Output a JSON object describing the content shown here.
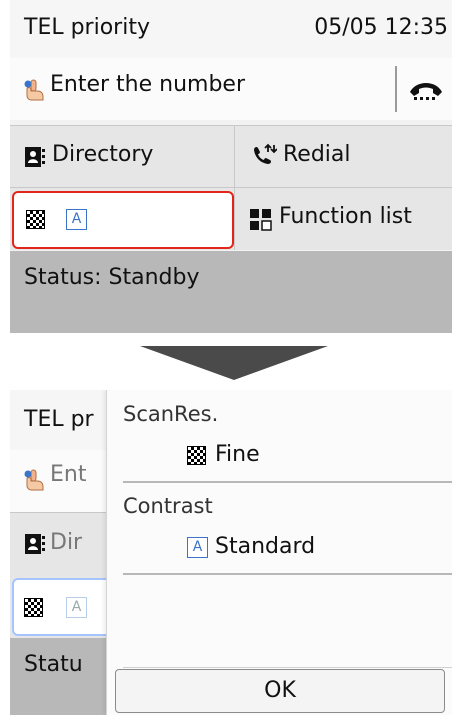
{
  "top": {
    "header": {
      "title": "TEL priority",
      "datetime": "05/05 12:35"
    },
    "enter_number": "Enter the number",
    "buttons": {
      "directory": "Directory",
      "redial": "Redial",
      "settings_contrast_letter": "A",
      "function_list": "Function list"
    },
    "status": "Status: Standby"
  },
  "bottom": {
    "behind": {
      "title_partial": "TEL pr",
      "enter_partial": "Ent",
      "directory_partial": "Dir",
      "status_partial": "Statu",
      "contrast_letter": "A"
    },
    "panel": {
      "scanres_label": "ScanRes.",
      "scanres_value": "Fine",
      "contrast_label": "Contrast",
      "contrast_letter": "A",
      "contrast_value": "Standard",
      "ok": "OK"
    }
  },
  "colors": {
    "selection_border": "#e2261c",
    "accent_blue": "#3b74c8"
  }
}
